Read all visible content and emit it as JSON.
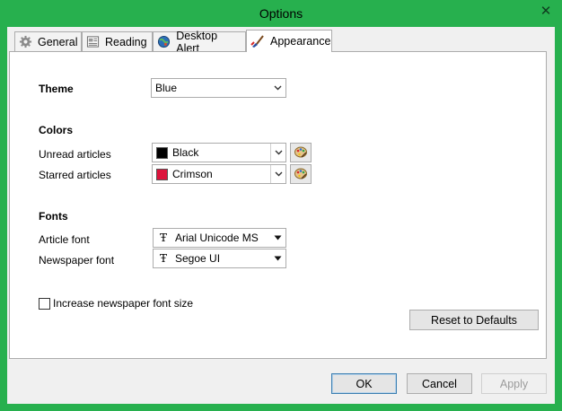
{
  "window": {
    "title": "Options",
    "close_glyph": "✕"
  },
  "tabs": [
    {
      "label": "General",
      "icon": "gear-icon"
    },
    {
      "label": "Reading",
      "icon": "newspaper-icon"
    },
    {
      "label": "Desktop Alert",
      "icon": "globe-icon"
    },
    {
      "label": "Appearance",
      "icon": "brush-icon",
      "active": true
    }
  ],
  "appearance": {
    "theme_label": "Theme",
    "theme_value": "Blue",
    "colors_heading": "Colors",
    "unread_label": "Unread articles",
    "unread_value": "Black",
    "unread_color": "#000000",
    "starred_label": "Starred articles",
    "starred_value": "Crimson",
    "starred_color": "#dc143c",
    "fonts_heading": "Fonts",
    "article_font_label": "Article font",
    "article_font_value": "Arial Unicode MS",
    "newspaper_font_label": "Newspaper font",
    "newspaper_font_value": "Segoe UI",
    "font_glyph": "Ŧ",
    "increase_size_label": "Increase newspaper font size",
    "increase_size_checked": false,
    "reset_label": "Reset to Defaults"
  },
  "footer": {
    "ok_label": "OK",
    "cancel_label": "Cancel",
    "apply_label": "Apply"
  },
  "colors": {
    "titlebar": "#27b04e",
    "dialog_bg": "#f0f0f0",
    "panel_bg": "#ffffff"
  }
}
